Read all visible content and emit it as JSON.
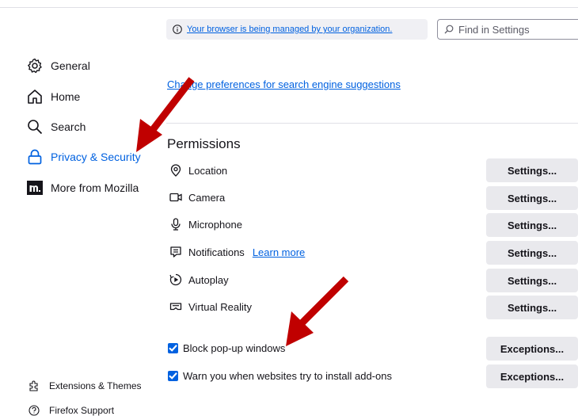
{
  "banner": {
    "text": "Your browser is being managed by your organization."
  },
  "search": {
    "placeholder": "Find in Settings"
  },
  "sidebar": {
    "items": [
      {
        "label": "General",
        "icon": "gear-icon"
      },
      {
        "label": "Home",
        "icon": "home-icon"
      },
      {
        "label": "Search",
        "icon": "search-icon"
      },
      {
        "label": "Privacy & Security",
        "icon": "lock-icon",
        "active": true
      },
      {
        "label": "More from Mozilla",
        "icon": "mozilla-icon"
      }
    ],
    "footer": [
      {
        "label": "Extensions & Themes",
        "icon": "puzzle-icon"
      },
      {
        "label": "Firefox Support",
        "icon": "help-icon"
      }
    ]
  },
  "search_section": {
    "change_link": "Change preferences for search engine suggestions"
  },
  "permissions": {
    "title": "Permissions",
    "rows": [
      {
        "label": "Location",
        "icon": "location-icon",
        "button": "Settings..."
      },
      {
        "label": "Camera",
        "icon": "camera-icon",
        "button": "Settings..."
      },
      {
        "label": "Microphone",
        "icon": "microphone-icon",
        "button": "Settings..."
      },
      {
        "label": "Notifications",
        "icon": "notification-icon",
        "link": "Learn more",
        "button": "Settings..."
      },
      {
        "label": "Autoplay",
        "icon": "autoplay-icon",
        "button": "Settings..."
      },
      {
        "label": "Virtual Reality",
        "icon": "vr-icon",
        "button": "Settings..."
      }
    ],
    "checks": [
      {
        "label": "Block pop-up windows",
        "checked": true,
        "button": "Exceptions..."
      },
      {
        "label": "Warn you when websites try to install add-ons",
        "checked": true,
        "button": "Exceptions..."
      }
    ]
  },
  "colors": {
    "accent": "#0061e0",
    "annotation_arrow": "#c00000"
  }
}
